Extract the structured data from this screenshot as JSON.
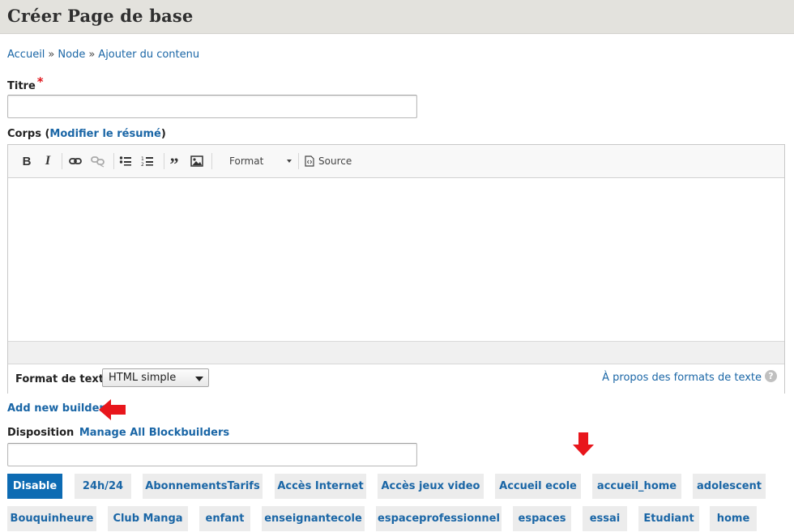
{
  "page": {
    "title": "Créer Page de base"
  },
  "breadcrumb": {
    "items": [
      "Accueil",
      "Node",
      "Ajouter du contenu"
    ],
    "separator": "»"
  },
  "form": {
    "title_label": "Titre",
    "required_marker": "*",
    "title_value": "",
    "body_label": "Corps",
    "body_summary_link": "Modifier le résumé",
    "paren_open": "(",
    "paren_close": ")"
  },
  "toolbar": {
    "bold_icon": "bold-icon",
    "italic_icon": "italic-icon",
    "link_icon": "link-icon",
    "unlink_icon": "unlink-icon",
    "bullet_list_icon": "bulleted-list-icon",
    "numbered_list_icon": "numbered-list-icon",
    "blockquote_icon": "blockquote-icon",
    "image_icon": "image-icon",
    "format_label": "Format",
    "source_label": "Source"
  },
  "text_format": {
    "label": "Format de texte",
    "selected": "HTML simple",
    "about_link": "À propos des formats de texte",
    "help_icon": "?"
  },
  "builder": {
    "add_new_label": "Add new builder",
    "disposition_label": "Disposition",
    "manage_link": "Manage All Blockbuilders",
    "disposition_value": ""
  },
  "tags": {
    "row1": [
      "Disable",
      "24h/24",
      "AbonnementsTarifs",
      "Accès Internet",
      "Accès jeux video",
      "Accueil ecole",
      "accueil_home",
      "adolescent"
    ],
    "row2": [
      "Bouquinheure",
      "Club Manga",
      "enfant",
      "enseignantecole",
      "espaceprofessionnel",
      "espaces",
      "essai",
      "Etudiant",
      "home"
    ]
  },
  "colors": {
    "link": "#1a66a6",
    "active_chip": "#0d6bb3",
    "required": "#e0161c",
    "annotation_arrow": "#e8161c",
    "header_bg": "#e3e2dd"
  }
}
